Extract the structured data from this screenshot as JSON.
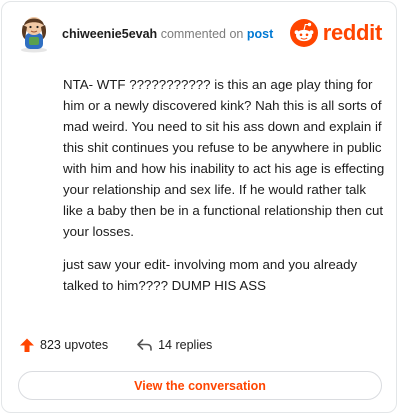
{
  "header": {
    "username": "chiweenie5evah",
    "verb": "commented on",
    "post_link": "post"
  },
  "brand": {
    "wordmark": "reddit",
    "icon": "reddit-snoo-icon",
    "color": "#ff4500"
  },
  "avatar": {
    "icon": "avatar-icon"
  },
  "comment": {
    "paragraphs": [
      "NTA- WTF ??????????? is this an age play thing for him or a newly discovered kink? Nah this is all sorts of mad weird. You need to sit his ass down and explain if this shit continues you refuse to be anywhere in public with him and how his inability to act his age is effecting your relationship and sex life. If he would rather talk like a baby then be in a functional relationship then cut your losses.",
      "just saw your edit- involving mom and you already talked to him???? DUMP HIS ASS"
    ]
  },
  "actions": {
    "upvotes": "823 upvotes",
    "replies": "14 replies",
    "upvote_icon": "upvote-arrow-icon",
    "reply_icon": "reply-arrow-icon"
  },
  "cta": {
    "label": "View the conversation"
  },
  "colors": {
    "accent": "#ff4500",
    "link": "#0079d3",
    "muted": "#7c7c7c"
  }
}
